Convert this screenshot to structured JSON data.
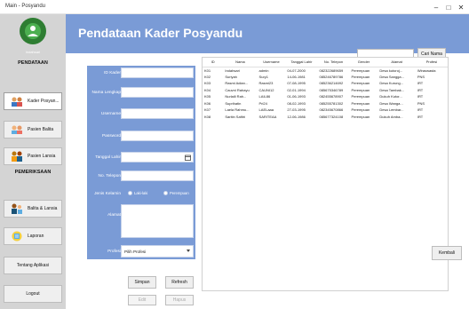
{
  "window": {
    "title": "Main - Posyandu",
    "controls": [
      "–",
      "□",
      "✕"
    ]
  },
  "sidebar": {
    "logo_text": "Indahsari",
    "section_pendataan": "PENDATAAN",
    "btn_kader": "Kader Posyan...",
    "btn_balita": "Pasien Balita",
    "btn_lansia": "Pasien Lansia",
    "section_pemeriksaan": "PEMERIKSAAN",
    "btn_balita_lansia": "Balita & Lansia",
    "btn_laporan": "Laporan",
    "btn_tentang": "Tentang Aplikasi",
    "btn_logout": "Logout"
  },
  "header": {
    "title": "Pendataan Kader Posyandu"
  },
  "form": {
    "label_id": "ID Kader",
    "label_nama": "Nama Lengkap",
    "label_username": "Username",
    "label_password": "Password",
    "label_tgl": "Tanggal Lahir",
    "label_telp": "No. Telepon",
    "label_jk": "Jenis Kelamin",
    "radio_laki": "Laki-laki",
    "radio_perempuan": "Perempuan",
    "label_alamat": "Alamat",
    "label_profesi": "Profesi",
    "profesi_value": "Pilih Profesi",
    "btn_simpan": "Simpan",
    "btn_refresh": "Refresh",
    "btn_edit": "Edit",
    "btn_hapus": "Hapus"
  },
  "search": {
    "button": "Cari Nama"
  },
  "table": {
    "headers": [
      "ID",
      "Nama",
      "Username",
      "Tanggal Lahir",
      "No. Telepon",
      "Gender",
      "Alamat",
      "Profesi"
    ],
    "rows": [
      [
        "K01",
        "Indahsari",
        "admin",
        "04-07-2000",
        "082322689659",
        "Perempuan",
        "Desa kutoroj...",
        "Wiraswasta"
      ],
      [
        "K02",
        "Suriyah",
        "Sury1",
        "14-06-1981",
        "085246789786",
        "Perempuan",
        "Desa Sangga...",
        "PNS"
      ],
      [
        "K03",
        "Rasmi Adian...",
        "Rasmi23",
        "07-08-1995",
        "085236214692",
        "Perempuan",
        "Desa Kurung...",
        "IRT"
      ],
      [
        "K04",
        "Cauvni Rahayu",
        "CAUNI12",
        "02-01-1994",
        "085675346789",
        "Perempuan",
        "Desa Tambak...",
        "IRT"
      ],
      [
        "K05",
        "Nurlaili Rah...",
        "LAIL86",
        "01-06-1993",
        "082455678907",
        "Perempuan",
        "Dukuh Kutor...",
        "IRT"
      ],
      [
        "K06",
        "Suprihatin",
        "Pri24",
        "08-02-1993",
        "085255781302",
        "Perempuan",
        "Desa Wanga...",
        "PNS"
      ],
      [
        "K07",
        "Laela Rahmu...",
        "LAELaaa",
        "27-03-1995",
        "082345670866",
        "Perempuan",
        "Desa Lembar...",
        "IRT"
      ],
      [
        "K08",
        "Saritin Safitri",
        "SARITEAA",
        "12-06-1986",
        "085677324108",
        "Perempuan",
        "Dukuh Amba...",
        "IRT"
      ]
    ]
  },
  "btn_kembali": "Kembali",
  "colors": {
    "accent": "#7a9bd6",
    "sidebar": "#d4d4d4",
    "logo": "#2e7d32"
  }
}
